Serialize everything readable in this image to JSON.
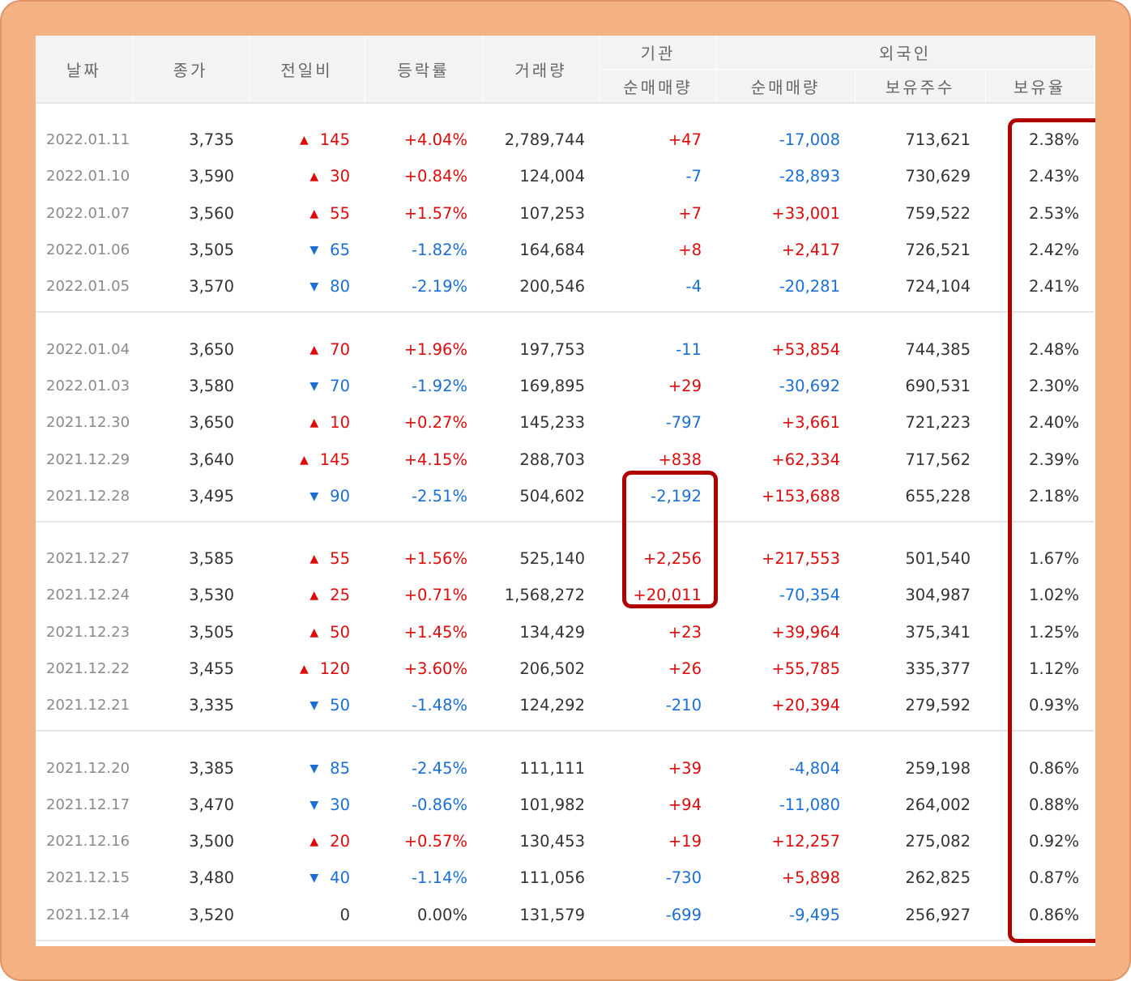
{
  "header": {
    "date": "날짜",
    "close": "종가",
    "change": "전일비",
    "rate": "등락률",
    "volume": "거래량",
    "institution": "기관",
    "inst_net": "순매매량",
    "foreign": "외국인",
    "foreign_net": "순매매량",
    "foreign_shares": "보유주수",
    "foreign_ratio": "보유율"
  },
  "rows": [
    {
      "date": "2022.01.11",
      "close": "3,735",
      "dir": "up",
      "arrow": "▲",
      "change": "145",
      "rate": "+4.04%",
      "volume": "2,789,744",
      "inst": "+47",
      "inst_sign": "red",
      "foreign": "-17,008",
      "foreign_sign": "blue",
      "shares": "713,621",
      "ratio": "2.38%"
    },
    {
      "date": "2022.01.10",
      "close": "3,590",
      "dir": "up",
      "arrow": "▲",
      "change": "30",
      "rate": "+0.84%",
      "volume": "124,004",
      "inst": "-7",
      "inst_sign": "blue",
      "foreign": "-28,893",
      "foreign_sign": "blue",
      "shares": "730,629",
      "ratio": "2.43%"
    },
    {
      "date": "2022.01.07",
      "close": "3,560",
      "dir": "up",
      "arrow": "▲",
      "change": "55",
      "rate": "+1.57%",
      "volume": "107,253",
      "inst": "+7",
      "inst_sign": "red",
      "foreign": "+33,001",
      "foreign_sign": "red",
      "shares": "759,522",
      "ratio": "2.53%"
    },
    {
      "date": "2022.01.06",
      "close": "3,505",
      "dir": "down",
      "arrow": "▼",
      "change": "65",
      "rate": "-1.82%",
      "volume": "164,684",
      "inst": "+8",
      "inst_sign": "red",
      "foreign": "+2,417",
      "foreign_sign": "red",
      "shares": "726,521",
      "ratio": "2.42%"
    },
    {
      "date": "2022.01.05",
      "close": "3,570",
      "dir": "down",
      "arrow": "▼",
      "change": "80",
      "rate": "-2.19%",
      "volume": "200,546",
      "inst": "-4",
      "inst_sign": "blue",
      "foreign": "-20,281",
      "foreign_sign": "blue",
      "shares": "724,104",
      "ratio": "2.41%"
    },
    {
      "date": "2022.01.04",
      "close": "3,650",
      "dir": "up",
      "arrow": "▲",
      "change": "70",
      "rate": "+1.96%",
      "volume": "197,753",
      "inst": "-11",
      "inst_sign": "blue",
      "foreign": "+53,854",
      "foreign_sign": "red",
      "shares": "744,385",
      "ratio": "2.48%"
    },
    {
      "date": "2022.01.03",
      "close": "3,580",
      "dir": "down",
      "arrow": "▼",
      "change": "70",
      "rate": "-1.92%",
      "volume": "169,895",
      "inst": "+29",
      "inst_sign": "red",
      "foreign": "-30,692",
      "foreign_sign": "blue",
      "shares": "690,531",
      "ratio": "2.30%"
    },
    {
      "date": "2021.12.30",
      "close": "3,650",
      "dir": "up",
      "arrow": "▲",
      "change": "10",
      "rate": "+0.27%",
      "volume": "145,233",
      "inst": "-797",
      "inst_sign": "blue",
      "foreign": "+3,661",
      "foreign_sign": "red",
      "shares": "721,223",
      "ratio": "2.40%"
    },
    {
      "date": "2021.12.29",
      "close": "3,640",
      "dir": "up",
      "arrow": "▲",
      "change": "145",
      "rate": "+4.15%",
      "volume": "288,703",
      "inst": "+838",
      "inst_sign": "red",
      "foreign": "+62,334",
      "foreign_sign": "red",
      "shares": "717,562",
      "ratio": "2.39%"
    },
    {
      "date": "2021.12.28",
      "close": "3,495",
      "dir": "down",
      "arrow": "▼",
      "change": "90",
      "rate": "-2.51%",
      "volume": "504,602",
      "inst": "-2,192",
      "inst_sign": "blue",
      "foreign": "+153,688",
      "foreign_sign": "red",
      "shares": "655,228",
      "ratio": "2.18%"
    },
    {
      "date": "2021.12.27",
      "close": "3,585",
      "dir": "up",
      "arrow": "▲",
      "change": "55",
      "rate": "+1.56%",
      "volume": "525,140",
      "inst": "+2,256",
      "inst_sign": "red",
      "foreign": "+217,553",
      "foreign_sign": "red",
      "shares": "501,540",
      "ratio": "1.67%"
    },
    {
      "date": "2021.12.24",
      "close": "3,530",
      "dir": "up",
      "arrow": "▲",
      "change": "25",
      "rate": "+0.71%",
      "volume": "1,568,272",
      "inst": "+20,011",
      "inst_sign": "red",
      "foreign": "-70,354",
      "foreign_sign": "blue",
      "shares": "304,987",
      "ratio": "1.02%"
    },
    {
      "date": "2021.12.23",
      "close": "3,505",
      "dir": "up",
      "arrow": "▲",
      "change": "50",
      "rate": "+1.45%",
      "volume": "134,429",
      "inst": "+23",
      "inst_sign": "red",
      "foreign": "+39,964",
      "foreign_sign": "red",
      "shares": "375,341",
      "ratio": "1.25%"
    },
    {
      "date": "2021.12.22",
      "close": "3,455",
      "dir": "up",
      "arrow": "▲",
      "change": "120",
      "rate": "+3.60%",
      "volume": "206,502",
      "inst": "+26",
      "inst_sign": "red",
      "foreign": "+55,785",
      "foreign_sign": "red",
      "shares": "335,377",
      "ratio": "1.12%"
    },
    {
      "date": "2021.12.21",
      "close": "3,335",
      "dir": "down",
      "arrow": "▼",
      "change": "50",
      "rate": "-1.48%",
      "volume": "124,292",
      "inst": "-210",
      "inst_sign": "blue",
      "foreign": "+20,394",
      "foreign_sign": "red",
      "shares": "279,592",
      "ratio": "0.93%"
    },
    {
      "date": "2021.12.20",
      "close": "3,385",
      "dir": "down",
      "arrow": "▼",
      "change": "85",
      "rate": "-2.45%",
      "volume": "111,111",
      "inst": "+39",
      "inst_sign": "red",
      "foreign": "-4,804",
      "foreign_sign": "blue",
      "shares": "259,198",
      "ratio": "0.86%"
    },
    {
      "date": "2021.12.17",
      "close": "3,470",
      "dir": "down",
      "arrow": "▼",
      "change": "30",
      "rate": "-0.86%",
      "volume": "101,982",
      "inst": "+94",
      "inst_sign": "red",
      "foreign": "-11,080",
      "foreign_sign": "blue",
      "shares": "264,002",
      "ratio": "0.88%"
    },
    {
      "date": "2021.12.16",
      "close": "3,500",
      "dir": "up",
      "arrow": "▲",
      "change": "20",
      "rate": "+0.57%",
      "volume": "130,453",
      "inst": "+19",
      "inst_sign": "red",
      "foreign": "+12,257",
      "foreign_sign": "red",
      "shares": "275,082",
      "ratio": "0.92%"
    },
    {
      "date": "2021.12.15",
      "close": "3,480",
      "dir": "down",
      "arrow": "▼",
      "change": "40",
      "rate": "-1.14%",
      "volume": "111,056",
      "inst": "-730",
      "inst_sign": "blue",
      "foreign": "+5,898",
      "foreign_sign": "red",
      "shares": "262,825",
      "ratio": "0.87%"
    },
    {
      "date": "2021.12.14",
      "close": "3,520",
      "dir": "flat",
      "arrow": "",
      "change": "0",
      "rate": "0.00%",
      "volume": "131,579",
      "inst": "-699",
      "inst_sign": "blue",
      "foreign": "-9,495",
      "foreign_sign": "blue",
      "shares": "256,927",
      "ratio": "0.86%"
    }
  ],
  "colors": {
    "frame": "#f4b183",
    "up": "#dd0b0b",
    "down": "#1a6fd6",
    "highlight": "#b00000"
  }
}
